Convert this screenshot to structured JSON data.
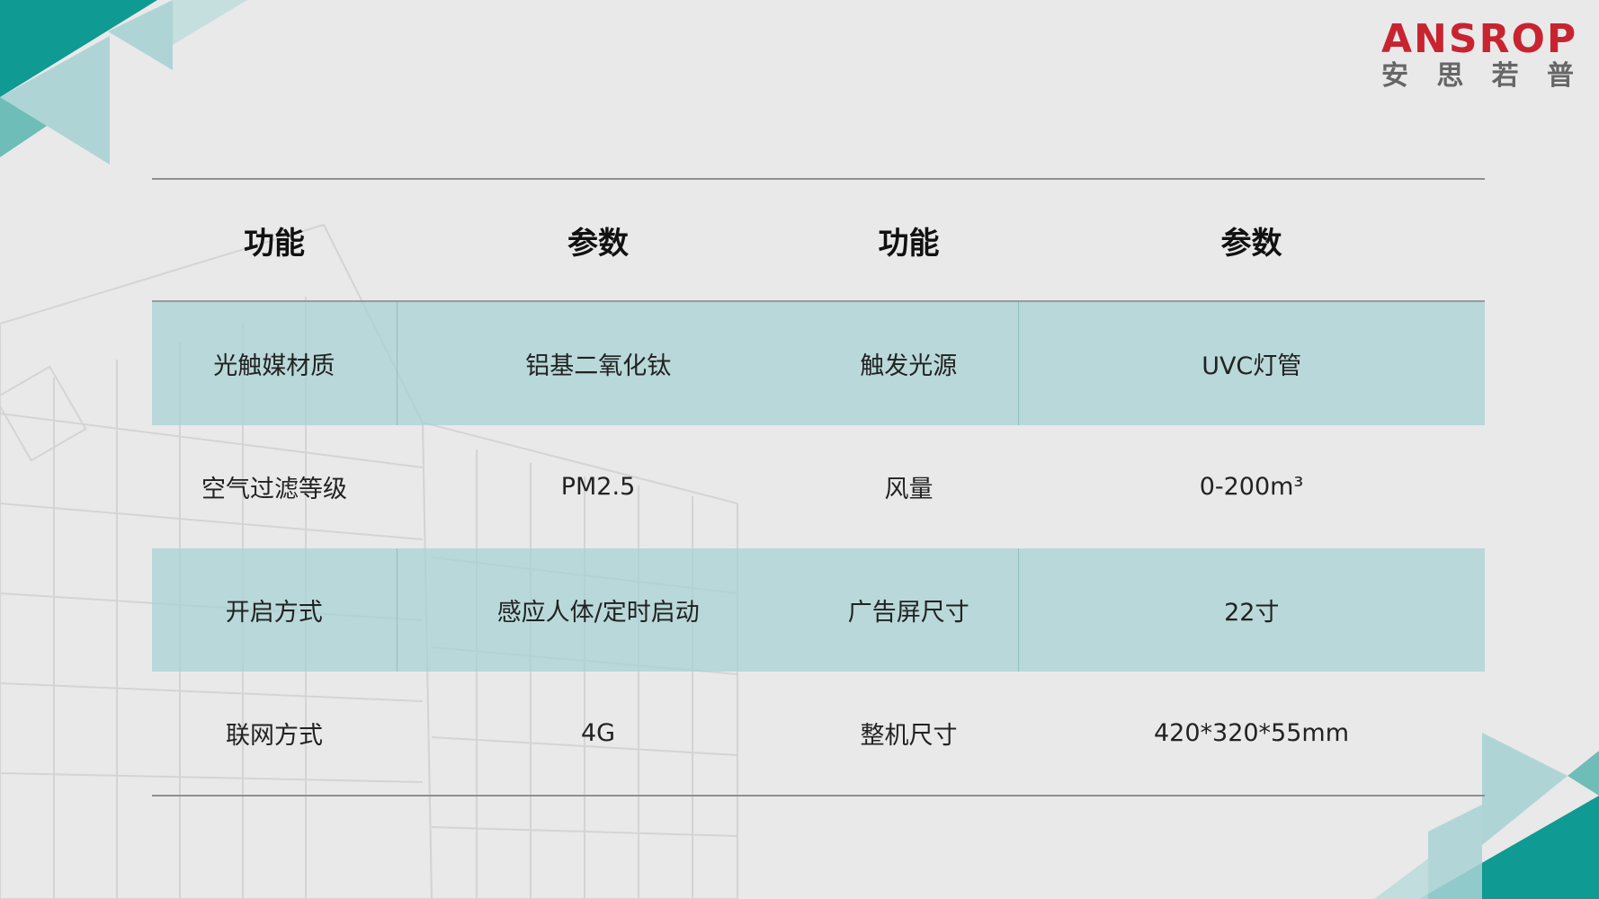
{
  "logo": {
    "en": "ANSROP",
    "cn": [
      "安",
      "思",
      "若",
      "普"
    ]
  },
  "table": {
    "headers": [
      "功能",
      "参数",
      "功能",
      "参数"
    ],
    "rows": [
      [
        "光触媒材质",
        "铝基二氧化钛",
        "触发光源",
        "UVC灯管"
      ],
      [
        "空气过滤等级",
        "PM2.5",
        "风量",
        "0-200m³"
      ],
      [
        "开启方式",
        "感应人体/定时启动",
        "广告屏尺寸",
        "22寸"
      ],
      [
        "联网方式",
        "4G",
        "整机尺寸",
        "420*320*55mm"
      ]
    ]
  },
  "colors": {
    "brand_red": "#c8242f",
    "teal_dark": "#0f9a93",
    "teal_light": "#a8d2d3",
    "background": "#e9e9e9"
  }
}
